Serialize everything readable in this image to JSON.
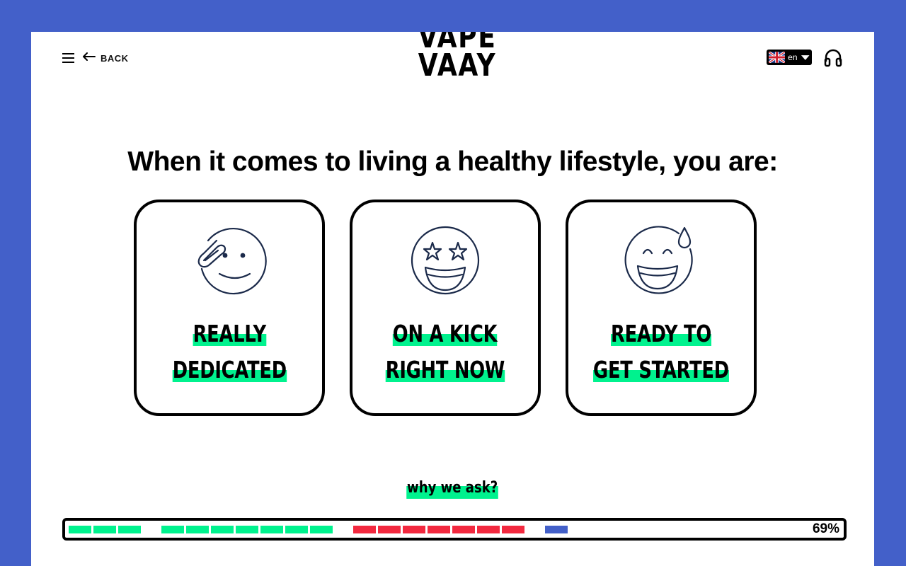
{
  "header": {
    "back_label": "BACK",
    "logo_lines": [
      "VAPE",
      "VAAY"
    ],
    "language": "en",
    "icons": {
      "menu": "hamburger-menu-icon",
      "back": "arrow-left-icon",
      "flag": "uk-flag-icon",
      "caret": "caret-down-icon",
      "support": "headphones-icon"
    }
  },
  "question": "When it comes to living a healthy lifestyle, you are:",
  "options": [
    {
      "icon": "saluting-face-icon",
      "lines": [
        "REALLY",
        "DEDICATED"
      ]
    },
    {
      "icon": "star-struck-face-icon",
      "lines": [
        "ON A KICK",
        "RIGHT NOW"
      ]
    },
    {
      "icon": "grinning-sweat-face-icon",
      "lines": [
        "READY TO",
        "GET STARTED"
      ]
    }
  ],
  "why_link": "why we ask?",
  "progress": {
    "percent_label": "69%",
    "percent": 69,
    "groups": [
      {
        "color": "#00f28e",
        "filled": 3
      },
      {
        "color": "#00f28e",
        "filled": 7
      },
      {
        "color": "#f2293f",
        "filled": 7
      },
      {
        "color": "#4360c9",
        "filled": 1
      }
    ]
  },
  "colors": {
    "background": "#4360c9",
    "highlight": "#00f28e",
    "warning": "#f2293f",
    "icon_stroke": "#1b2a4a"
  }
}
